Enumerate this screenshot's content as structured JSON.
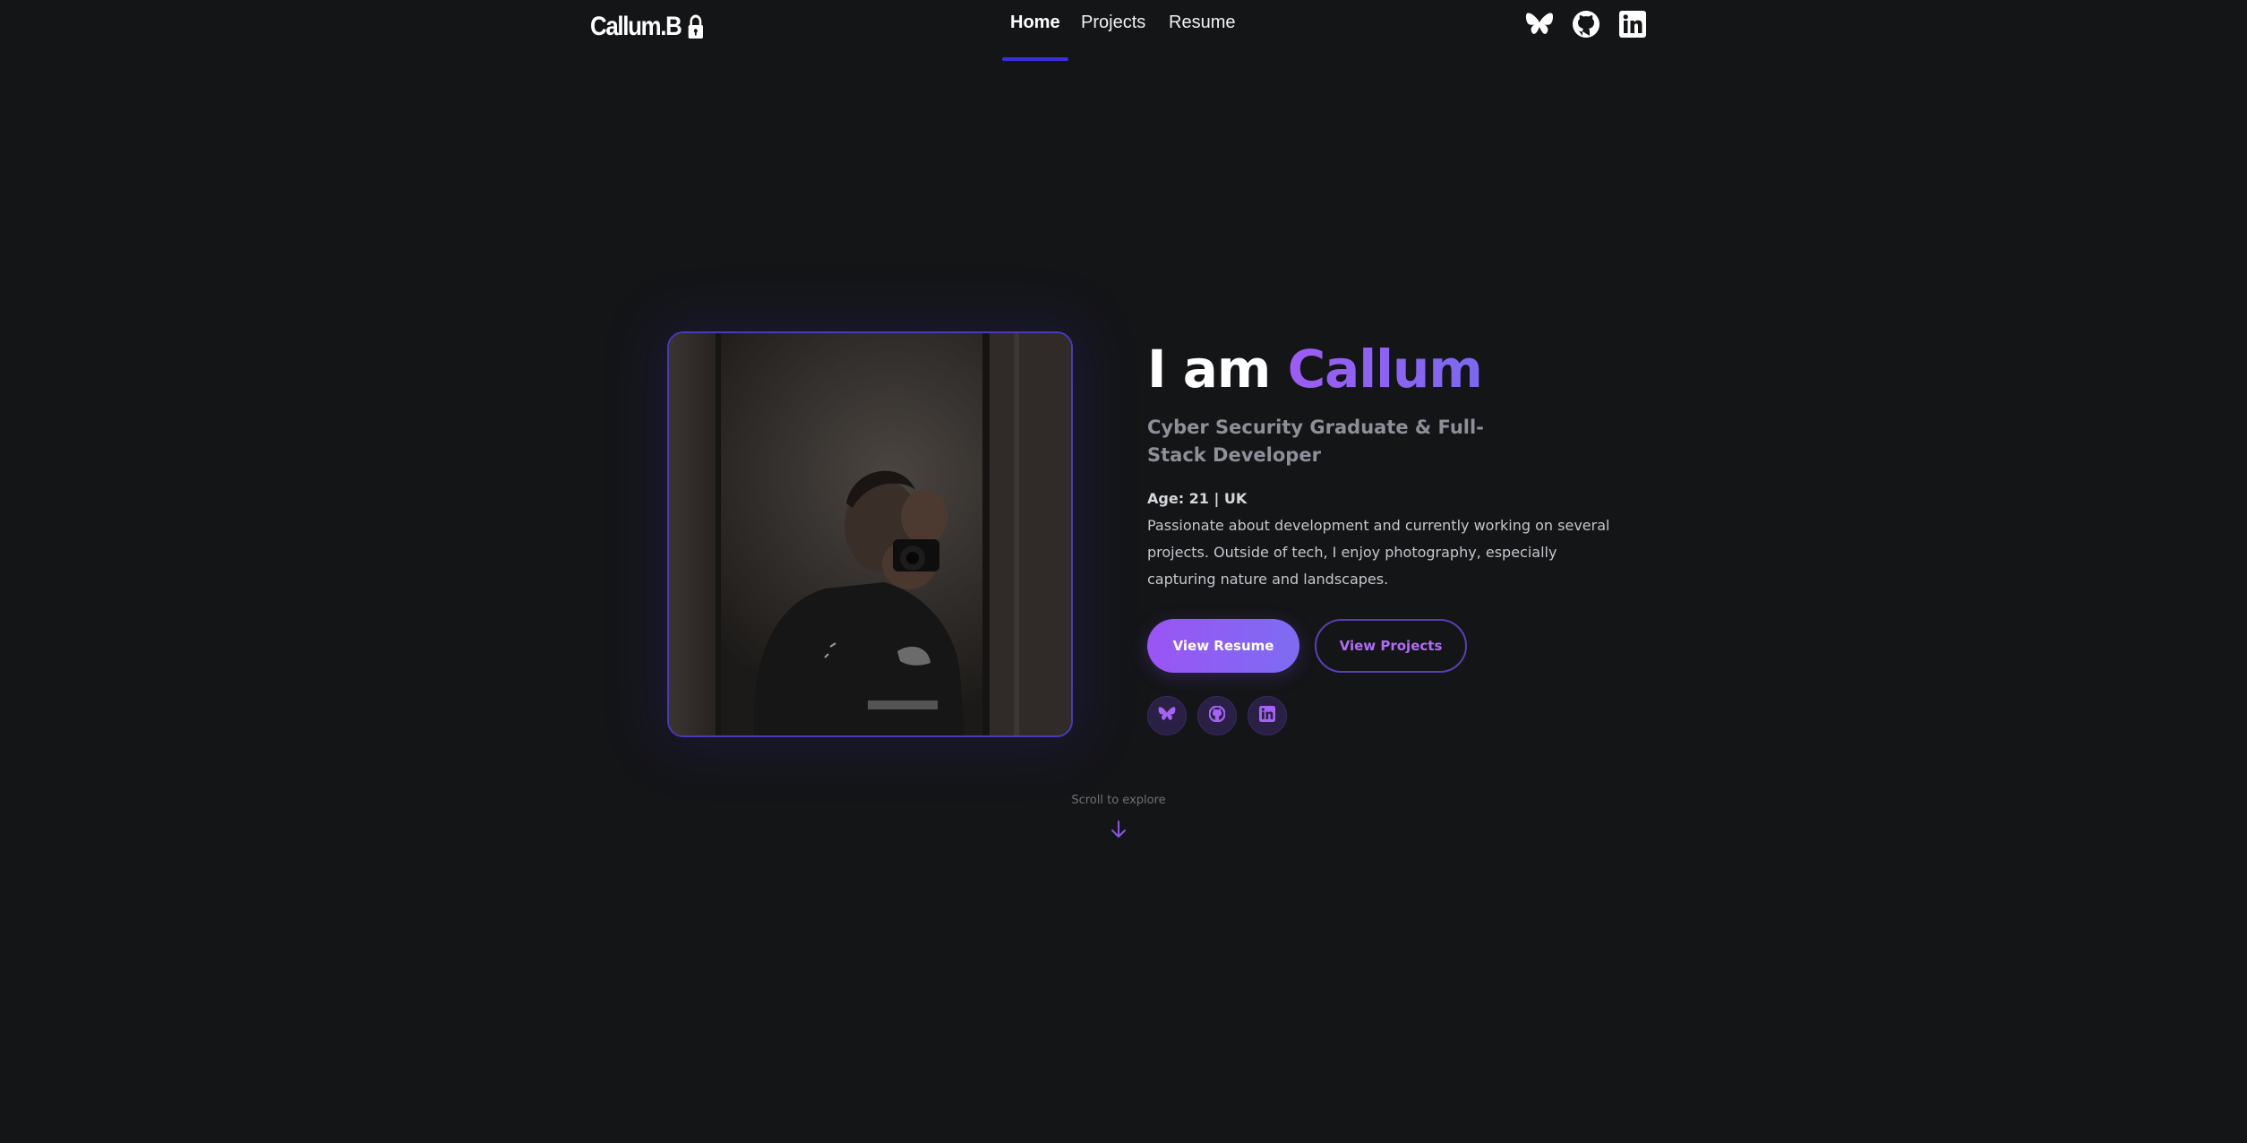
{
  "nav": {
    "brand": "Callum.B",
    "links": [
      {
        "label": "Home",
        "active": true
      },
      {
        "label": "Projects",
        "active": false
      },
      {
        "label": "Resume",
        "active": false
      }
    ],
    "social_icons": [
      "butterfly-icon",
      "github-icon",
      "linkedin-icon"
    ]
  },
  "hero": {
    "greeting": "I am",
    "name": "Callum",
    "subtitle": "Cyber Security Graduate & Full-Stack Developer",
    "age_line": "Age: 21 | UK",
    "bio": "Passionate about development and currently working on several projects. Outside of tech, I enjoy photography, especially capturing nature and landscapes.",
    "primary_button": "View Resume",
    "secondary_button": "View Projects",
    "social_icons": [
      "butterfly-icon",
      "github-icon",
      "linkedin-icon"
    ]
  },
  "scroll_hint": "Scroll to explore",
  "colors": {
    "background": "#141517",
    "accent_purple": "#9d5cf5",
    "accent_blue": "#3b2ee0",
    "muted_text": "#8e8f98"
  }
}
